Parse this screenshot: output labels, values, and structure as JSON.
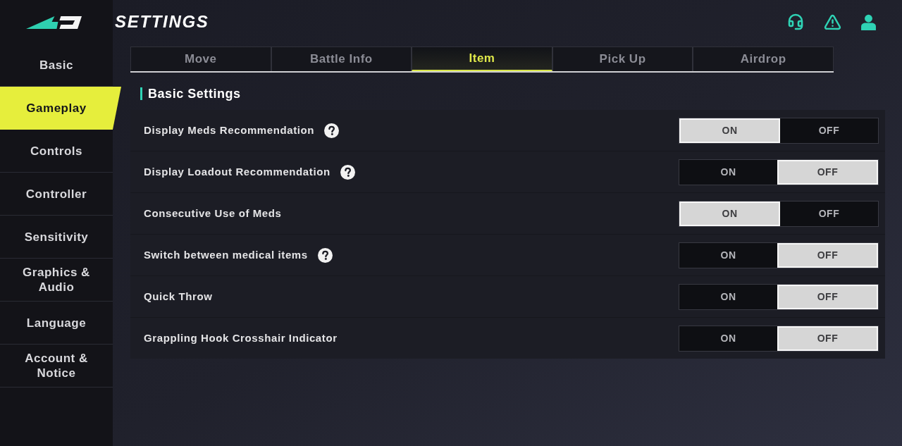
{
  "header": {
    "title": "SETTINGS"
  },
  "sidebar": {
    "items": [
      {
        "label": "Basic",
        "selected": false
      },
      {
        "label": "Gameplay",
        "selected": true
      },
      {
        "label": "Controls",
        "selected": false
      },
      {
        "label": "Controller",
        "selected": false
      },
      {
        "label": "Sensitivity",
        "selected": false
      },
      {
        "label": "Graphics & Audio",
        "selected": false
      },
      {
        "label": "Language",
        "selected": false
      },
      {
        "label": "Account & Notice",
        "selected": false
      }
    ]
  },
  "tabs": [
    {
      "label": "Move",
      "selected": false
    },
    {
      "label": "Battle Info",
      "selected": false
    },
    {
      "label": "Item",
      "selected": true
    },
    {
      "label": "Pick Up",
      "selected": false
    },
    {
      "label": "Airdrop",
      "selected": false
    }
  ],
  "section": {
    "title": "Basic Settings"
  },
  "settings": [
    {
      "label": "Display Meds Recommendation",
      "help": true,
      "options": [
        {
          "label": "ON",
          "selected": true
        },
        {
          "label": "OFF",
          "selected": false
        }
      ]
    },
    {
      "label": "Display Loadout Recommendation",
      "help": true,
      "options": [
        {
          "label": "ON",
          "selected": false
        },
        {
          "label": "OFF",
          "selected": true
        }
      ]
    },
    {
      "label": "Consecutive Use of Meds",
      "help": false,
      "options": [
        {
          "label": "ON",
          "selected": true
        },
        {
          "label": "OFF",
          "selected": false
        }
      ]
    },
    {
      "label": "Switch between medical items",
      "help": true,
      "options": [
        {
          "label": "ON",
          "selected": false
        },
        {
          "label": "OFF",
          "selected": true
        }
      ]
    },
    {
      "label": "Quick Throw",
      "help": false,
      "options": [
        {
          "label": "ON",
          "selected": false
        },
        {
          "label": "OFF",
          "selected": true
        }
      ]
    },
    {
      "label": "Grappling Hook Crosshair Indicator",
      "help": false,
      "options": [
        {
          "label": "ON",
          "selected": false
        },
        {
          "label": "OFF",
          "selected": true
        }
      ]
    }
  ]
}
